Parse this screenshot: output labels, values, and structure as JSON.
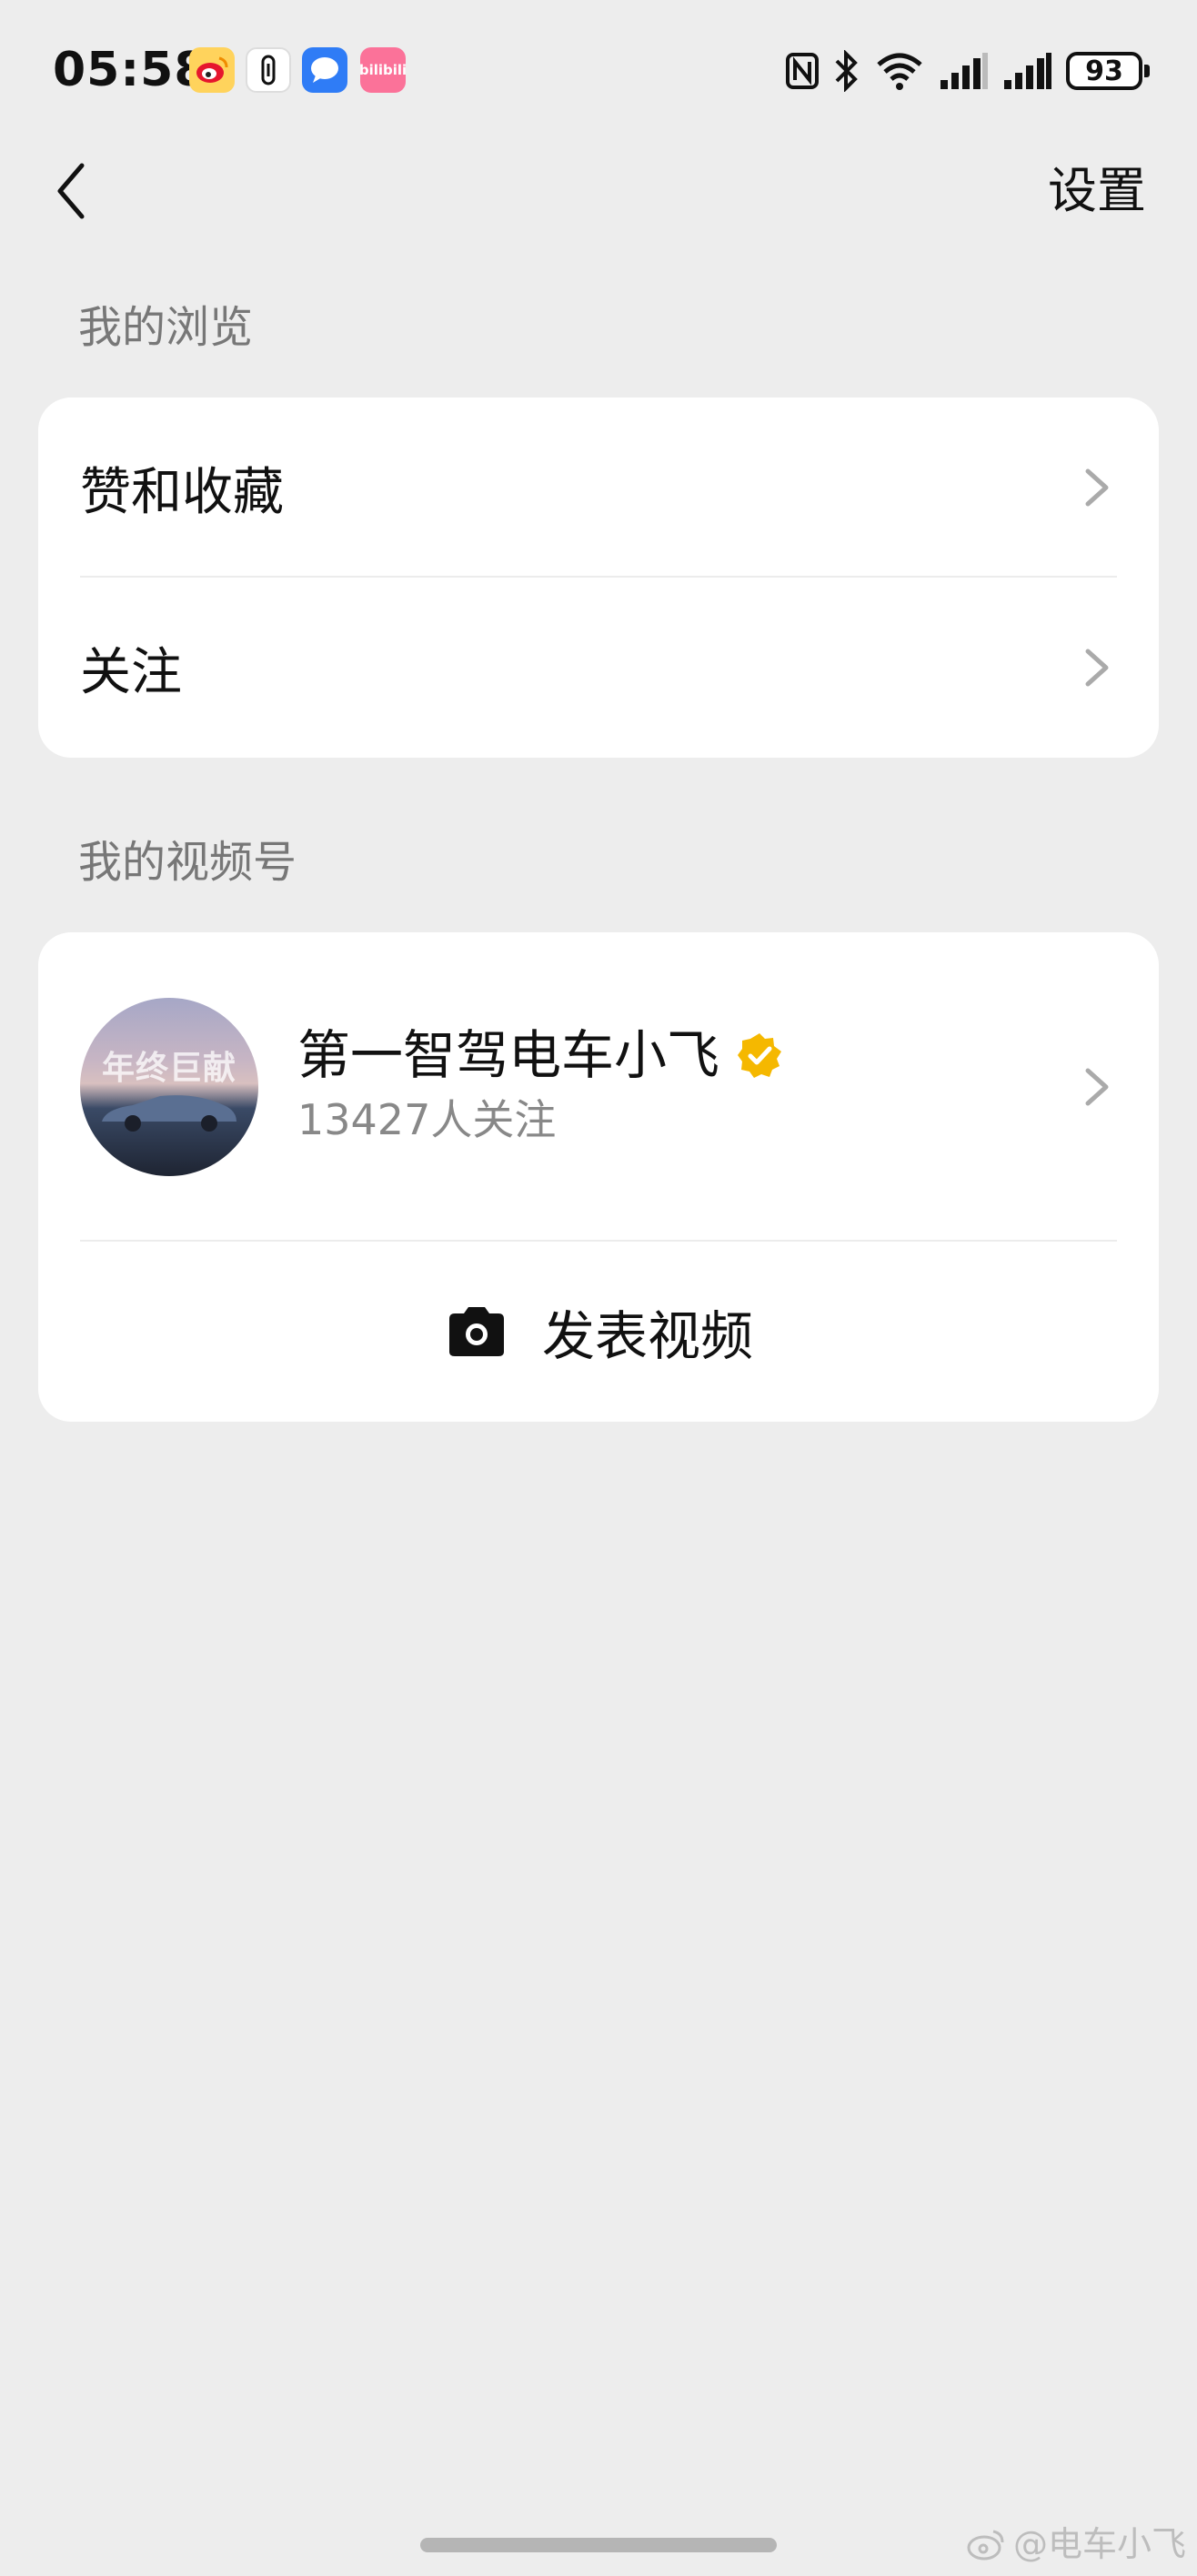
{
  "status_bar": {
    "time": "05:58",
    "battery": "93",
    "apps": [
      "weibo-icon",
      "vpn-key-icon",
      "message-icon",
      "bilibili-icon"
    ],
    "bilibili_text": "bilibili"
  },
  "header": {
    "settings_label": "设置"
  },
  "browse_section": {
    "title": "我的浏览",
    "items": [
      {
        "label": "赞和收藏"
      },
      {
        "label": "关注"
      }
    ]
  },
  "channel_section": {
    "title": "我的视频号",
    "channel": {
      "name": "第一智驾电车小飞",
      "followers": "13427人关注",
      "avatar_text": "年终巨献",
      "verified_color": "#f5b800"
    },
    "publish_label": "发表视频"
  },
  "watermark": "@电车小飞"
}
